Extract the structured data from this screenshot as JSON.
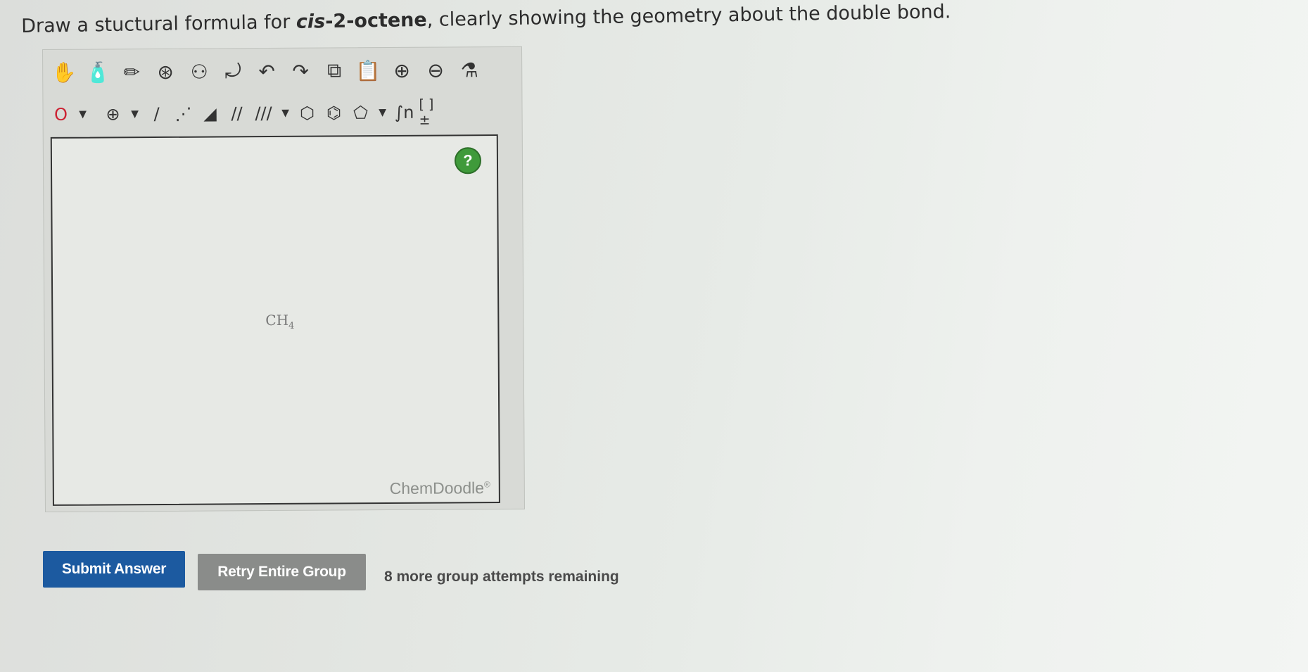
{
  "question": {
    "prefix": "Draw a stuctural formula for ",
    "compound": "cis-2-octene",
    "compound_italic": "cis",
    "compound_rest": "-2-octene",
    "suffix": ", clearly showing the geometry about the double bond."
  },
  "toolbar_top": [
    {
      "name": "hand-icon",
      "glyph": "✋"
    },
    {
      "name": "clear-icon",
      "glyph": "🧴"
    },
    {
      "name": "eraser-icon",
      "glyph": "✏"
    },
    {
      "name": "center-icon",
      "glyph": "⊛"
    },
    {
      "name": "flip-icon",
      "glyph": "⚇"
    },
    {
      "name": "rotate-icon",
      "glyph": "⤾"
    },
    {
      "name": "undo-icon",
      "glyph": "↶"
    },
    {
      "name": "redo-icon",
      "glyph": "↷"
    },
    {
      "name": "copy-icon",
      "glyph": "⧉"
    },
    {
      "name": "paste-icon",
      "glyph": "📋"
    },
    {
      "name": "zoom-in-icon",
      "glyph": "⊕"
    },
    {
      "name": "zoom-out-icon",
      "glyph": "⊖"
    },
    {
      "name": "clean-icon",
      "glyph": "⚗"
    }
  ],
  "toolbar_bottom": {
    "atom_label": "O",
    "charge_label": "⊕",
    "single_bond": "/",
    "recessed_bond": "⋰",
    "wedge_bond": "◢",
    "double_bond": "//",
    "triple_bond": "///",
    "ring6": "⬡",
    "benzene": "⌬",
    "ring5": "⬠",
    "repeat_unit": "∫n",
    "bracket": "[ ]±"
  },
  "canvas": {
    "help_label": "?",
    "molecule": "CH",
    "molecule_sub": "4",
    "brand": "ChemDoodle",
    "brand_mark": "®"
  },
  "actions": {
    "submit_label": "Submit Answer",
    "retry_label": "Retry Entire Group",
    "attempts_text": "8 more group attempts remaining"
  },
  "colors": {
    "submit": "#1c5aa0",
    "retry": "#8a8c8a",
    "help": "#3f9a3a"
  }
}
